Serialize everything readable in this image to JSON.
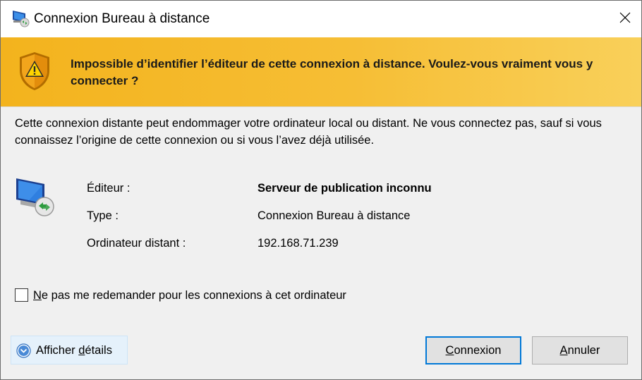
{
  "window": {
    "title": "Connexion Bureau à distance",
    "app_icon": "remote-desktop-icon",
    "close_icon": "close-icon"
  },
  "banner": {
    "icon": "warning-shield-icon",
    "text": "Impossible d’identifier l’éditeur de cette connexion à distance. Voulez-vous vraiment vous y connecter ?",
    "color": "#f4b52a"
  },
  "body": {
    "description": "Cette connexion distante peut endommager votre ordinateur local ou distant. Ne vous connectez pas, sauf si vous connaissez l’origine de cette connexion ou si vous l’avez déjà utilisée.",
    "icon": "remote-computer-icon",
    "rows": [
      {
        "label": "Éditeur :",
        "value": "Serveur de publication inconnu"
      },
      {
        "label": "Type :",
        "value": "Connexion Bureau à distance"
      },
      {
        "label": "Ordinateur distant :",
        "value": "192.168.71.239"
      }
    ]
  },
  "checkbox": {
    "label_mnemonic": "N",
    "label_rest": "e pas me redemander pour les connexions à cet ordinateur",
    "checked": false
  },
  "footer": {
    "details_prefix": "Afficher ",
    "details_mnemonic": "d",
    "details_rest": "étails",
    "details_icon": "chevron-down-circle-icon",
    "connect_mnemonic": "C",
    "connect_rest": "onnexion",
    "cancel_mnemonic": "A",
    "cancel_rest": "nnuler",
    "accent_color": "#0078d7"
  }
}
